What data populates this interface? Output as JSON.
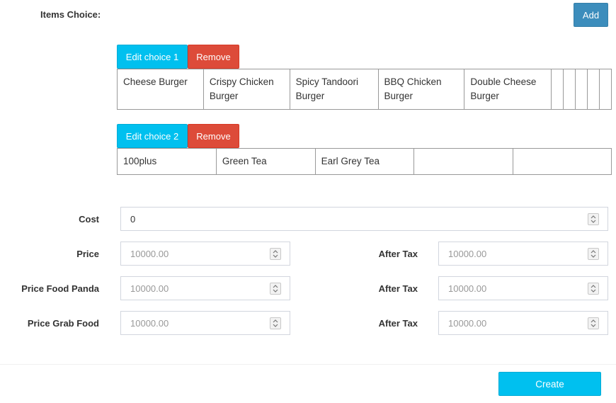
{
  "items_choice": {
    "label": "Items Choice:",
    "add_label": "Add"
  },
  "choices": [
    {
      "edit_label": "Edit choice 1",
      "remove_label": "Remove",
      "items": [
        "Cheese Burger",
        "Crispy Chicken Burger",
        "Spicy Tandoori Burger",
        "BBQ Chicken Burger",
        "Double Cheese Burger",
        "",
        "",
        "",
        "",
        ""
      ]
    },
    {
      "edit_label": "Edit choice 2",
      "remove_label": "Remove",
      "items": [
        "100plus",
        "Green Tea",
        "Earl Grey Tea",
        "",
        ""
      ]
    }
  ],
  "form": {
    "cost": {
      "label": "Cost",
      "value": "0"
    },
    "price": {
      "label": "Price",
      "placeholder": "10000.00"
    },
    "price_after_tax": {
      "label": "After Tax",
      "placeholder": "10000.00"
    },
    "price_food_panda": {
      "label": "Price Food Panda",
      "placeholder": "10000.00"
    },
    "food_panda_after_tax": {
      "label": "After Tax",
      "placeholder": "10000.00"
    },
    "price_grab_food": {
      "label": "Price Grab Food",
      "placeholder": "10000.00"
    },
    "grab_food_after_tax": {
      "label": "After Tax",
      "placeholder": "10000.00"
    }
  },
  "footer": {
    "create_label": "Create"
  },
  "colors": {
    "primary": "#3c8dbc",
    "info": "#00c0ef",
    "danger": "#dd4b39"
  }
}
